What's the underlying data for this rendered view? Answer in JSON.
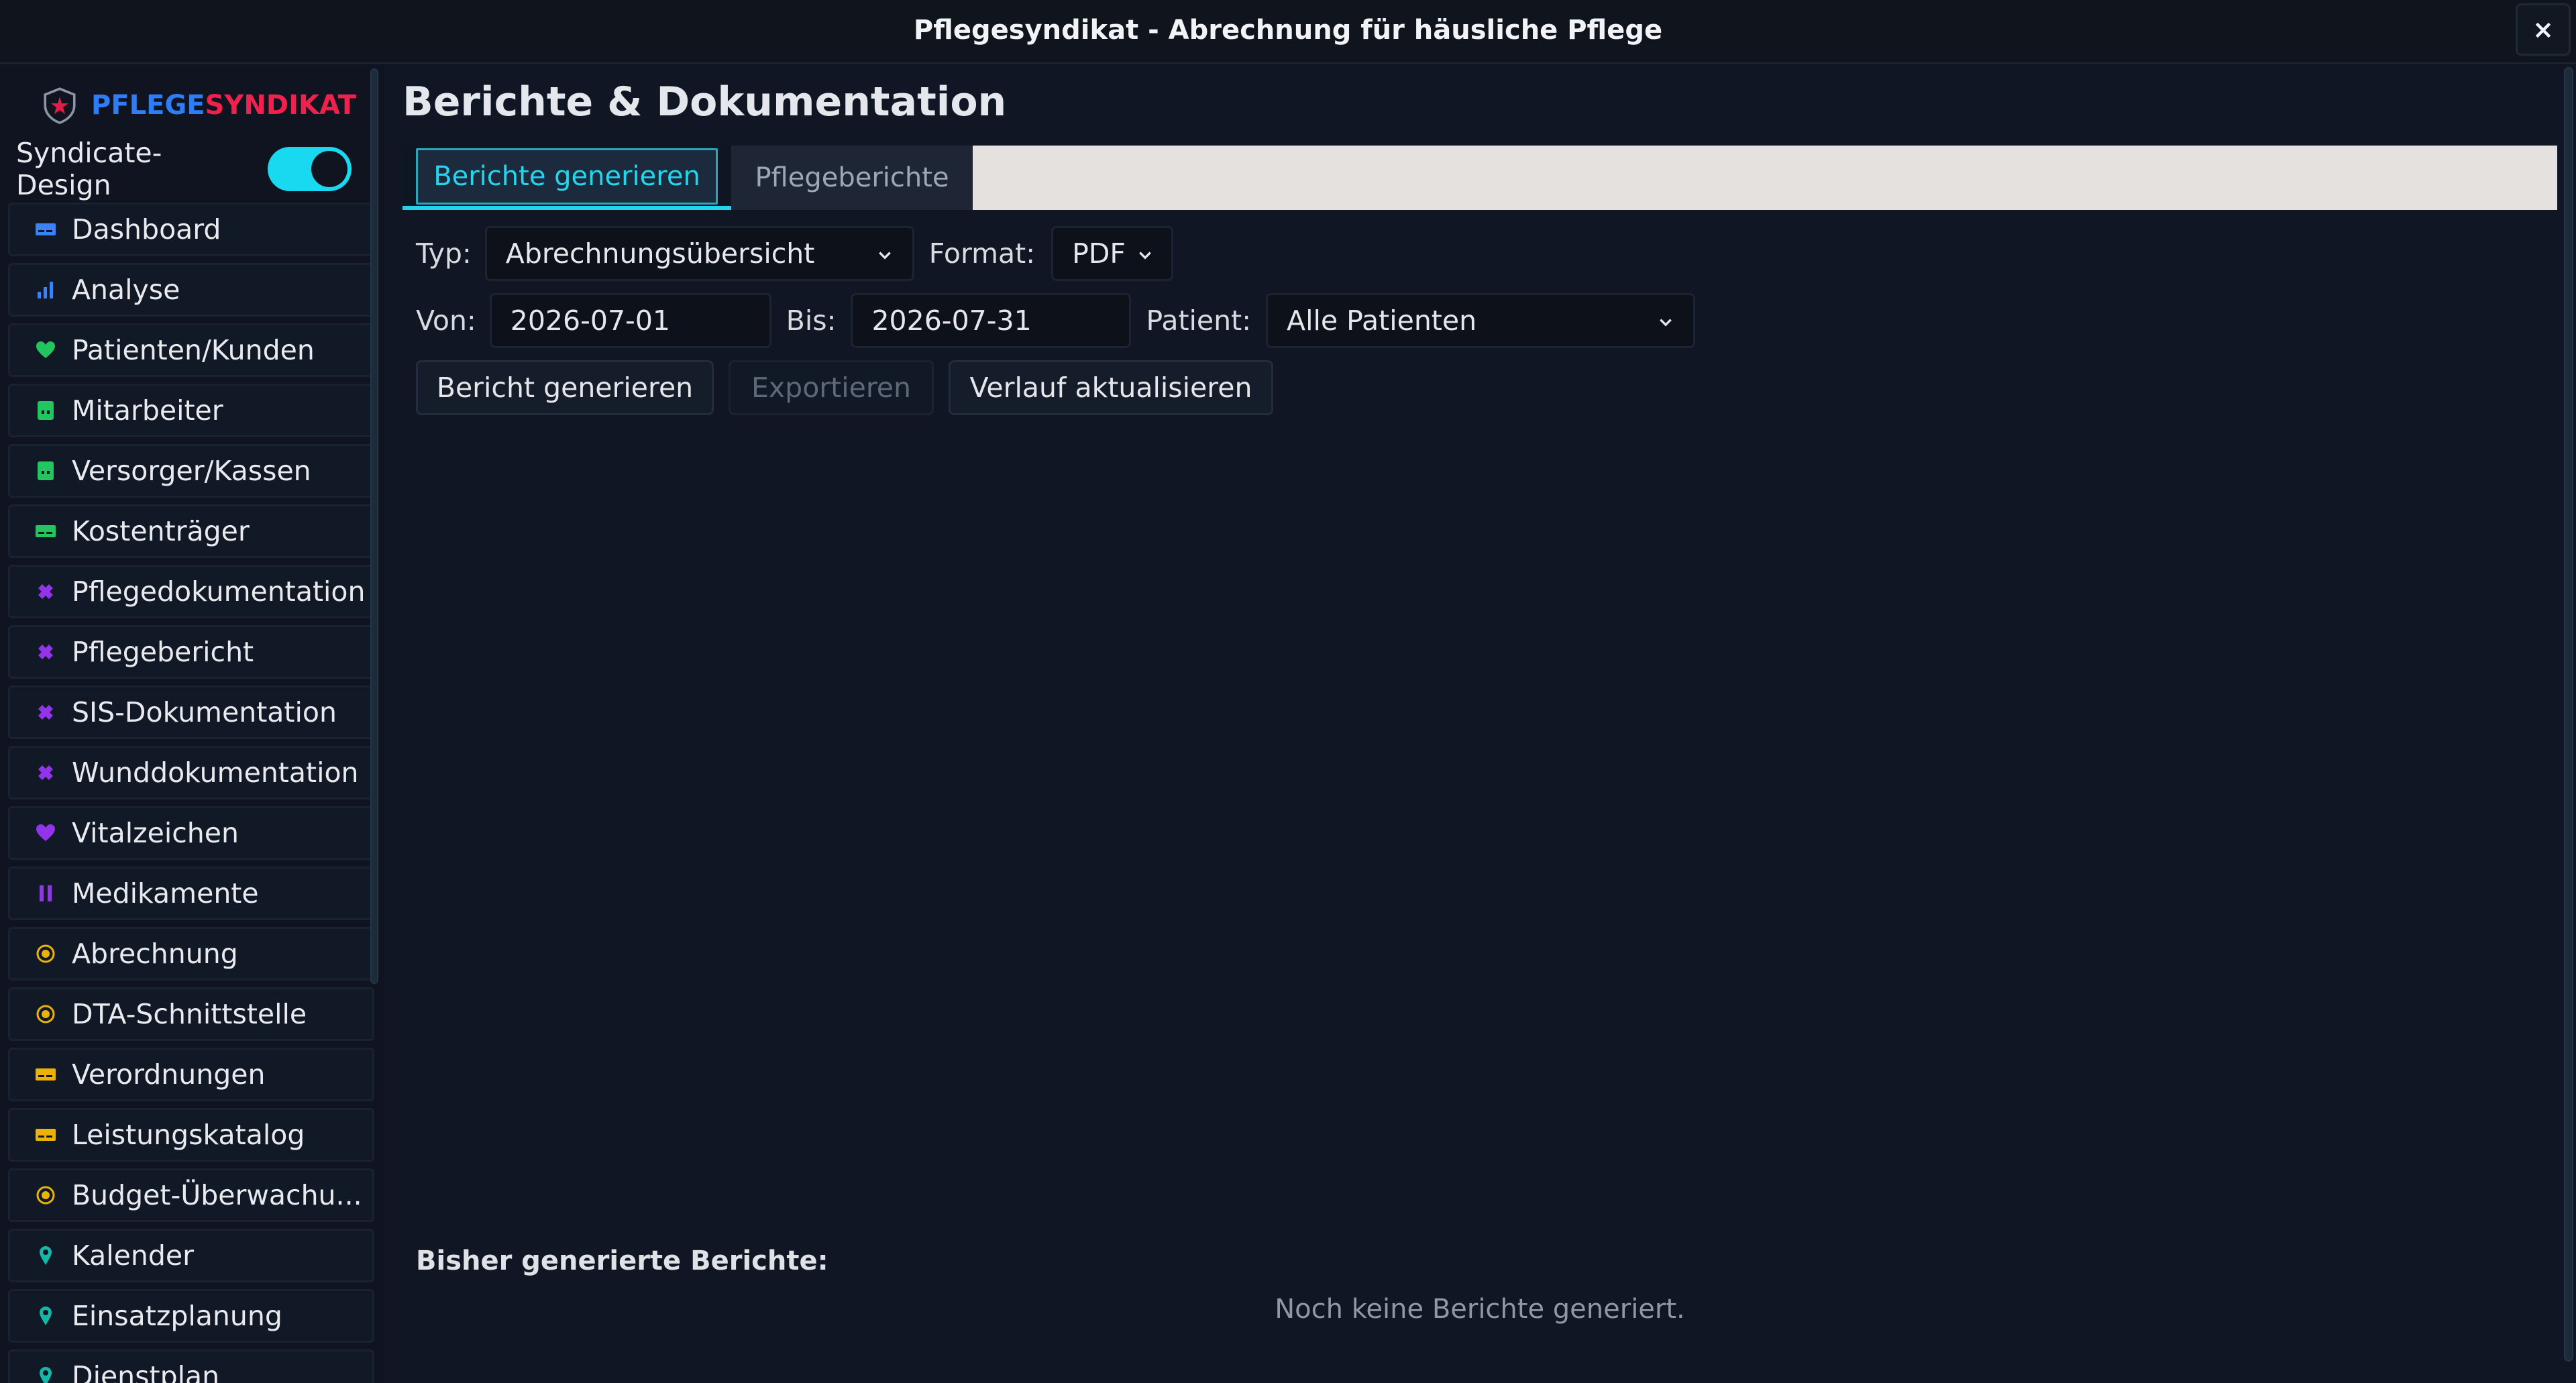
{
  "window": {
    "title": "Pflegesyndikat - Abrechnung für häusliche Pflege",
    "close_label": "×"
  },
  "brand": {
    "part1": "PFLEGE",
    "part2": "SYNDIKAT"
  },
  "design_toggle": {
    "label": "Syndicate-Design",
    "on": true
  },
  "sidebar": {
    "items": [
      {
        "label": "Dashboard",
        "icon": "card-icon",
        "color": "#3b82f6"
      },
      {
        "label": "Analyse",
        "icon": "bar-chart-icon",
        "color": "#3b82f6"
      },
      {
        "label": "Patienten/Kunden",
        "icon": "heart-icon",
        "color": "#22c55e"
      },
      {
        "label": "Mitarbeiter",
        "icon": "building-icon",
        "color": "#22c55e"
      },
      {
        "label": "Versorger/Kassen",
        "icon": "building-icon",
        "color": "#22c55e"
      },
      {
        "label": "Kostenträger",
        "icon": "card-icon",
        "color": "#22c55e"
      },
      {
        "label": "Pflegedokumentation",
        "icon": "puzzle-icon",
        "color": "#9333ea"
      },
      {
        "label": "Pflegebericht",
        "icon": "puzzle-icon",
        "color": "#9333ea"
      },
      {
        "label": "SIS-Dokumentation",
        "icon": "puzzle-icon",
        "color": "#9333ea"
      },
      {
        "label": "Wunddokumentation",
        "icon": "puzzle-icon",
        "color": "#9333ea"
      },
      {
        "label": "Vitalzeichen",
        "icon": "heart-icon",
        "color": "#9333ea"
      },
      {
        "label": "Medikamente",
        "icon": "pause-icon",
        "color": "#9333ea"
      },
      {
        "label": "Abrechnung",
        "icon": "coin-icon",
        "color": "#eab308"
      },
      {
        "label": "DTA-Schnittstelle",
        "icon": "coin-icon",
        "color": "#eab308"
      },
      {
        "label": "Verordnungen",
        "icon": "card-icon",
        "color": "#eab308"
      },
      {
        "label": "Leistungskatalog",
        "icon": "card-icon",
        "color": "#eab308"
      },
      {
        "label": "Budget-Überwachu...",
        "icon": "coin-icon",
        "color": "#eab308"
      },
      {
        "label": "Kalender",
        "icon": "pin-icon",
        "color": "#14b8a6"
      },
      {
        "label": "Einsatzplanung",
        "icon": "pin-icon",
        "color": "#14b8a6"
      },
      {
        "label": "Dienstplan",
        "icon": "pin-icon",
        "color": "#14b8a6"
      }
    ]
  },
  "main": {
    "title": "Berichte & Dokumentation",
    "tabs": [
      {
        "label": "Berichte generieren",
        "active": true
      },
      {
        "label": "Pflegeberichte",
        "active": false
      }
    ],
    "form": {
      "typ_label": "Typ:",
      "typ_value": "Abrechnungsübersicht",
      "format_label": "Format:",
      "format_value": "PDF",
      "von_label": "Von:",
      "von_value": "2026-07-01",
      "bis_label": "Bis:",
      "bis_value": "2026-07-31",
      "patient_label": "Patient:",
      "patient_value": "Alle Patienten"
    },
    "buttons": {
      "generate": "Bericht generieren",
      "export": "Exportieren",
      "refresh": "Verlauf aktualisieren"
    },
    "generated_title": "Bisher generierte Berichte:",
    "empty_message": "Noch keine Berichte generiert."
  },
  "colors": {
    "accent": "#22d3ee",
    "brand_blue": "#2f7df6",
    "brand_red": "#f0214c",
    "background": "#101623"
  }
}
